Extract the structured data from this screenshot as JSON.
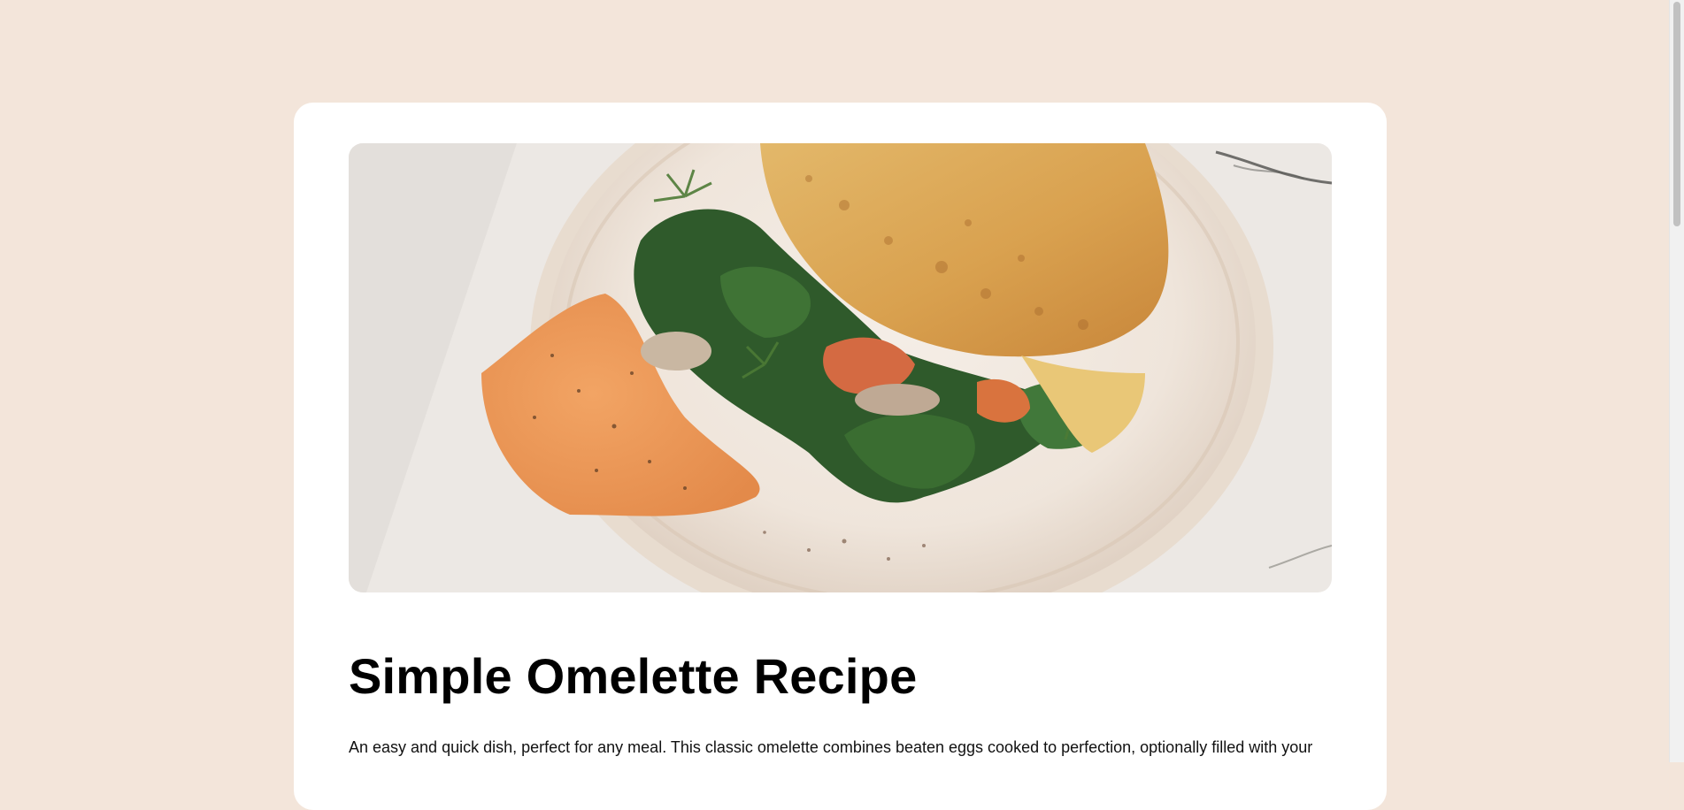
{
  "recipe": {
    "title": "Simple Omelette Recipe",
    "description": "An easy and quick dish, perfect for any meal. This classic omelette combines beaten eggs cooked to perfection, optionally filled with your"
  },
  "colors": {
    "page_bg": "#f3e5da",
    "card_bg": "#ffffff"
  },
  "icons": {
    "hero": "omelette-photo"
  }
}
